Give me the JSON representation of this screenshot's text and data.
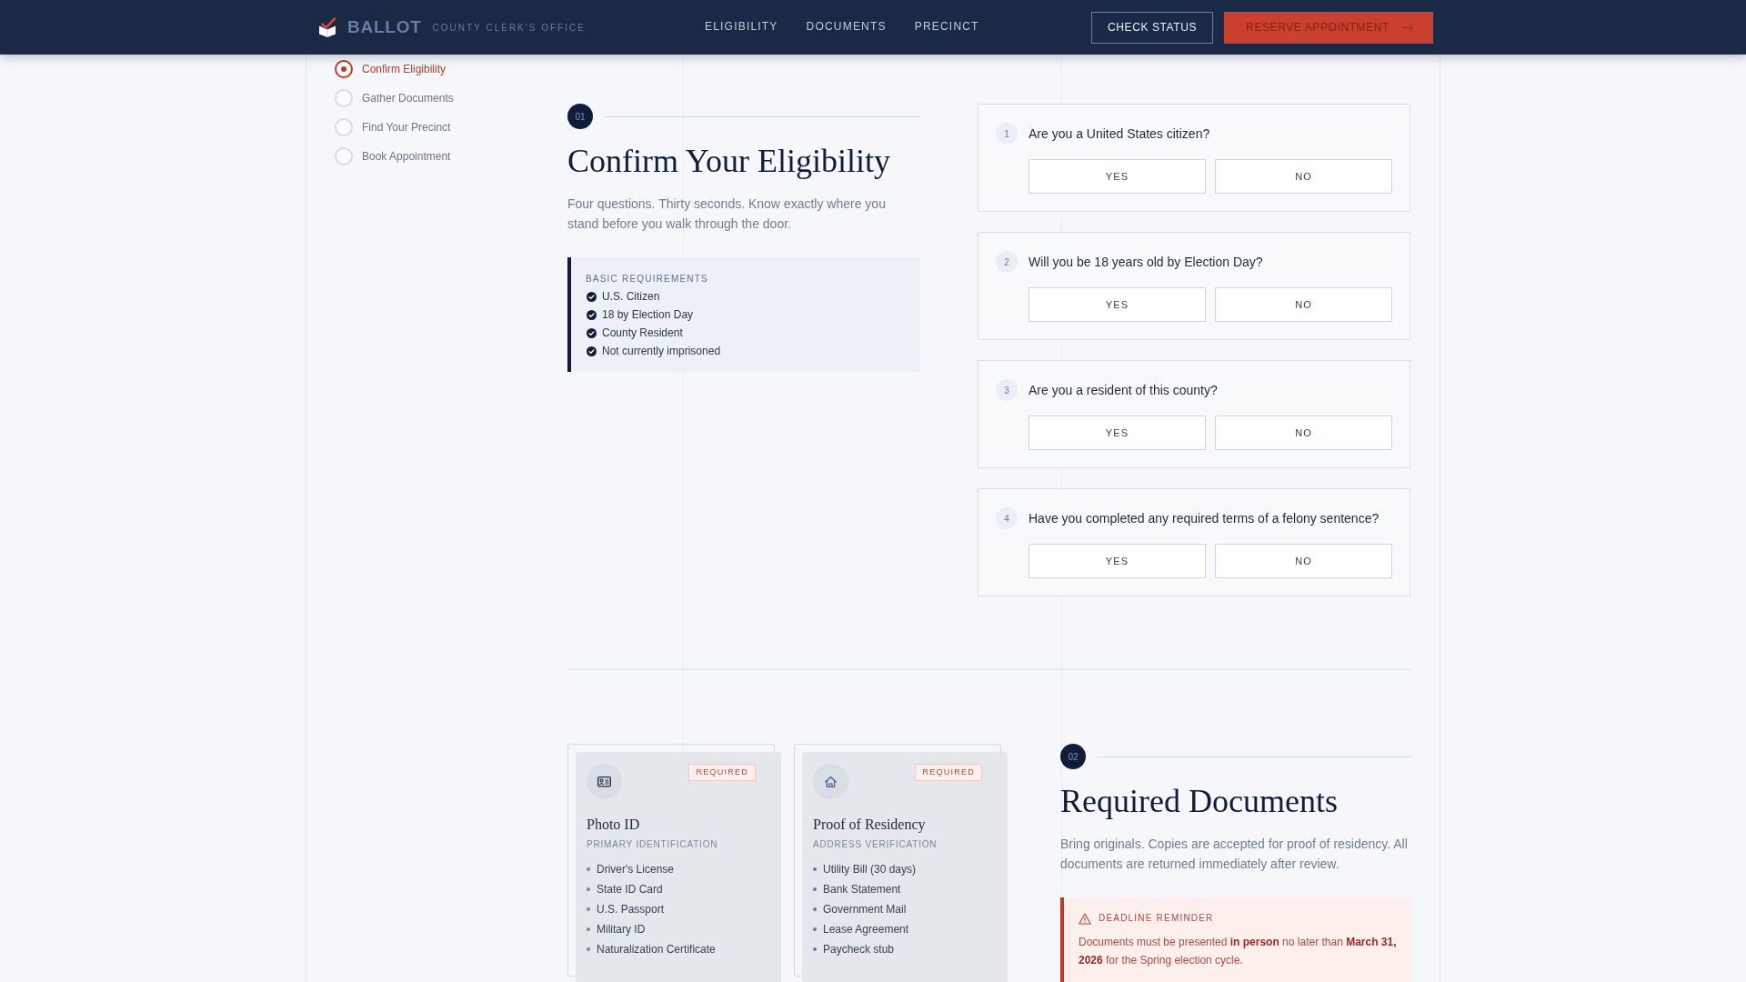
{
  "header": {
    "brand": "BALLOT",
    "office": "COUNTY CLERK'S OFFICE",
    "nav": [
      {
        "label": "ELIGIBILITY",
        "selected": false
      },
      {
        "label": "DOCUMENTS",
        "selected": false
      },
      {
        "label": "PRECINCT",
        "selected": false
      }
    ],
    "actions": [
      {
        "label": "CHECK STATUS",
        "kind": "outline"
      },
      {
        "label": "RESERVE APPOINTMENT",
        "kind": "primary"
      }
    ]
  },
  "steps": [
    {
      "label": "Confirm Eligibility",
      "selected": true
    },
    {
      "label": "Gather Documents",
      "selected": false
    },
    {
      "label": "Find Your Precinct",
      "selected": false
    },
    {
      "label": "Book Appointment",
      "selected": false
    }
  ],
  "eligibility": {
    "number": "01",
    "title": "Confirm Your Eligibility",
    "intro": "Four questions. Thirty seconds. Know exactly where you stand before you walk through the door.",
    "requirements": {
      "title": "BASIC REQUIREMENTS",
      "items": [
        "U.S. Citizen",
        "18 by Election Day",
        "County Resident",
        "Not currently imprisoned"
      ]
    },
    "questions": [
      {
        "number": "1",
        "text": "Are you a United States citizen?",
        "options": [
          {
            "label": "YES",
            "selected": false
          },
          {
            "label": "NO",
            "selected": false
          }
        ]
      },
      {
        "number": "2",
        "text": "Will you be 18 years old by Election Day?",
        "options": [
          {
            "label": "YES",
            "selected": false
          },
          {
            "label": "NO",
            "selected": false
          }
        ]
      },
      {
        "number": "3",
        "text": "Are you a resident of this county?",
        "options": [
          {
            "label": "YES",
            "selected": false
          },
          {
            "label": "NO",
            "selected": false
          }
        ]
      },
      {
        "number": "4",
        "text": "Have you completed any required terms of a felony sentence?",
        "options": [
          {
            "label": "YES",
            "selected": false
          },
          {
            "label": "NO",
            "selected": false
          }
        ]
      }
    ]
  },
  "documents": {
    "number": "02",
    "title": "Required Documents",
    "intro": "Bring originals. Copies are accepted for proof of residency. All documents are returned immediately after review.",
    "cards": [
      {
        "kind": "identity",
        "badge": "REQUIRED",
        "title": "Photo ID",
        "subtitle": "PRIMARY IDENTIFICATION",
        "items": [
          "Driver's License",
          "State ID Card",
          "U.S. Passport",
          "Military ID",
          "Naturalization Certificate"
        ]
      },
      {
        "kind": "residency",
        "badge": "REQUIRED",
        "title": "Proof of Residency",
        "subtitle": "ADDRESS VERIFICATION",
        "items": [
          "Utility Bill (30 days)",
          "Bank Statement",
          "Government Mail",
          "Lease Agreement",
          "Paycheck stub"
        ]
      }
    ],
    "notice": {
      "title": "DEADLINE REMINDER",
      "text": "Documents must be presented **in person** no later than **March 31, 2026** for the Spring election cycle."
    }
  }
}
